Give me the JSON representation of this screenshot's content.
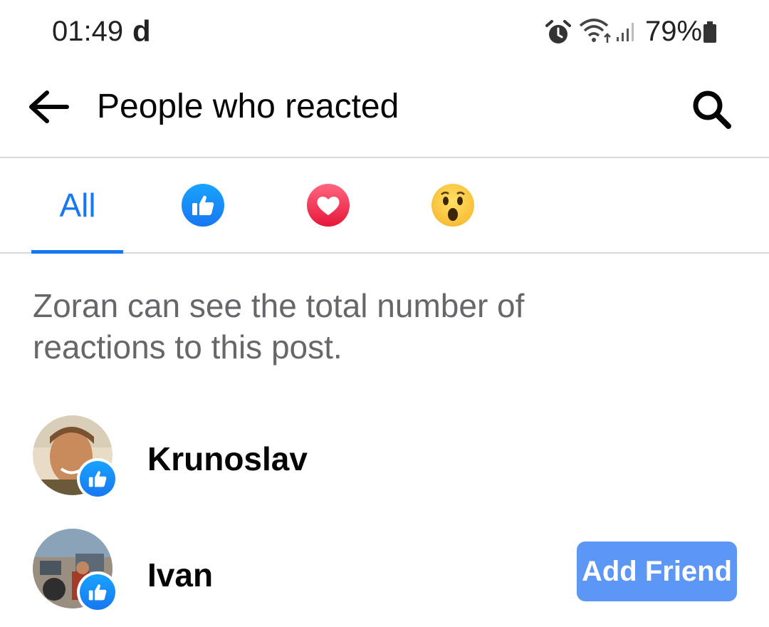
{
  "status_bar": {
    "time": "01:49",
    "carrier_icon_text": "d",
    "battery": "79%",
    "icons": [
      "alarm-icon",
      "wifi-icon",
      "signal-icon",
      "battery-icon"
    ]
  },
  "header": {
    "title": "People who reacted",
    "back_icon": "back-arrow-icon",
    "search_icon": "search-icon"
  },
  "tabs": [
    {
      "label": "All",
      "selected": true
    },
    {
      "icon": "like-reaction-icon",
      "color": "#1877f2"
    },
    {
      "icon": "love-reaction-icon",
      "color": "#f33e58"
    },
    {
      "icon": "wow-reaction-icon",
      "color": "#f7b125"
    }
  ],
  "info_text": "Zoran  can see the total number of reactions to this post.",
  "people": [
    {
      "name": "Krunoslav",
      "reaction": "like",
      "action": ""
    },
    {
      "name": "Ivan",
      "reaction": "like",
      "action": "Add Friend"
    }
  ],
  "colors": {
    "accent": "#1877f2",
    "secondary_text": "#65676b",
    "add_friend_button": "#5d97f5"
  }
}
